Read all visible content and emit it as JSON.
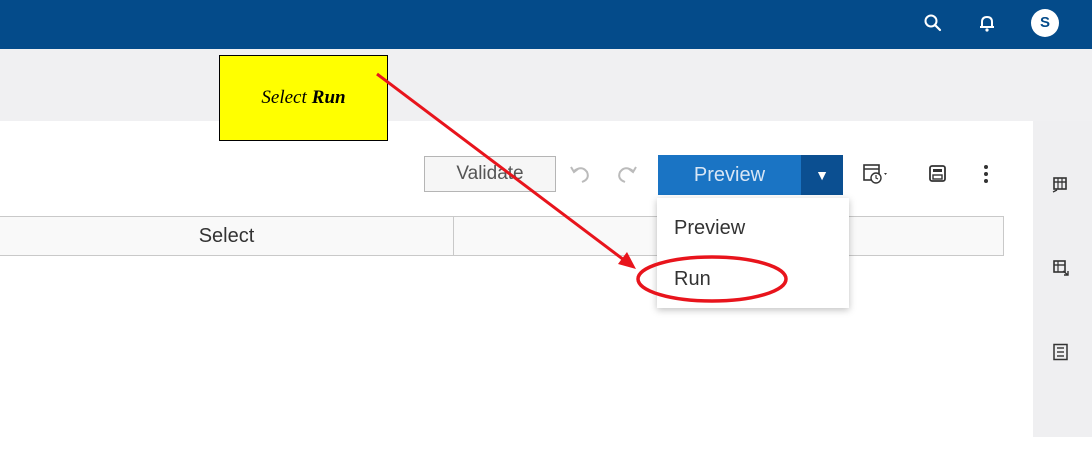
{
  "header": {
    "icons": [
      "search-icon",
      "bell-icon"
    ],
    "avatar_letter": "S",
    "color": "#044b8a"
  },
  "toolbar": {
    "validate_label": "Validate",
    "preview_label": "Preview",
    "icons": [
      "undo-icon",
      "redo-icon",
      "schedule-icon",
      "save-icon",
      "more-vertical-icon"
    ]
  },
  "table": {
    "columns": [
      "Select",
      ""
    ]
  },
  "dropdown_menu": {
    "items": [
      "Preview",
      "Run"
    ]
  },
  "right_panel": {
    "icons": [
      "table-columns-icon",
      "table-output-icon",
      "details-list-icon"
    ]
  },
  "annotation": {
    "callout_prefix": "Select",
    "callout_bold": "Run",
    "callout_color": "#ffff00",
    "arrow_color": "#e8141c"
  }
}
